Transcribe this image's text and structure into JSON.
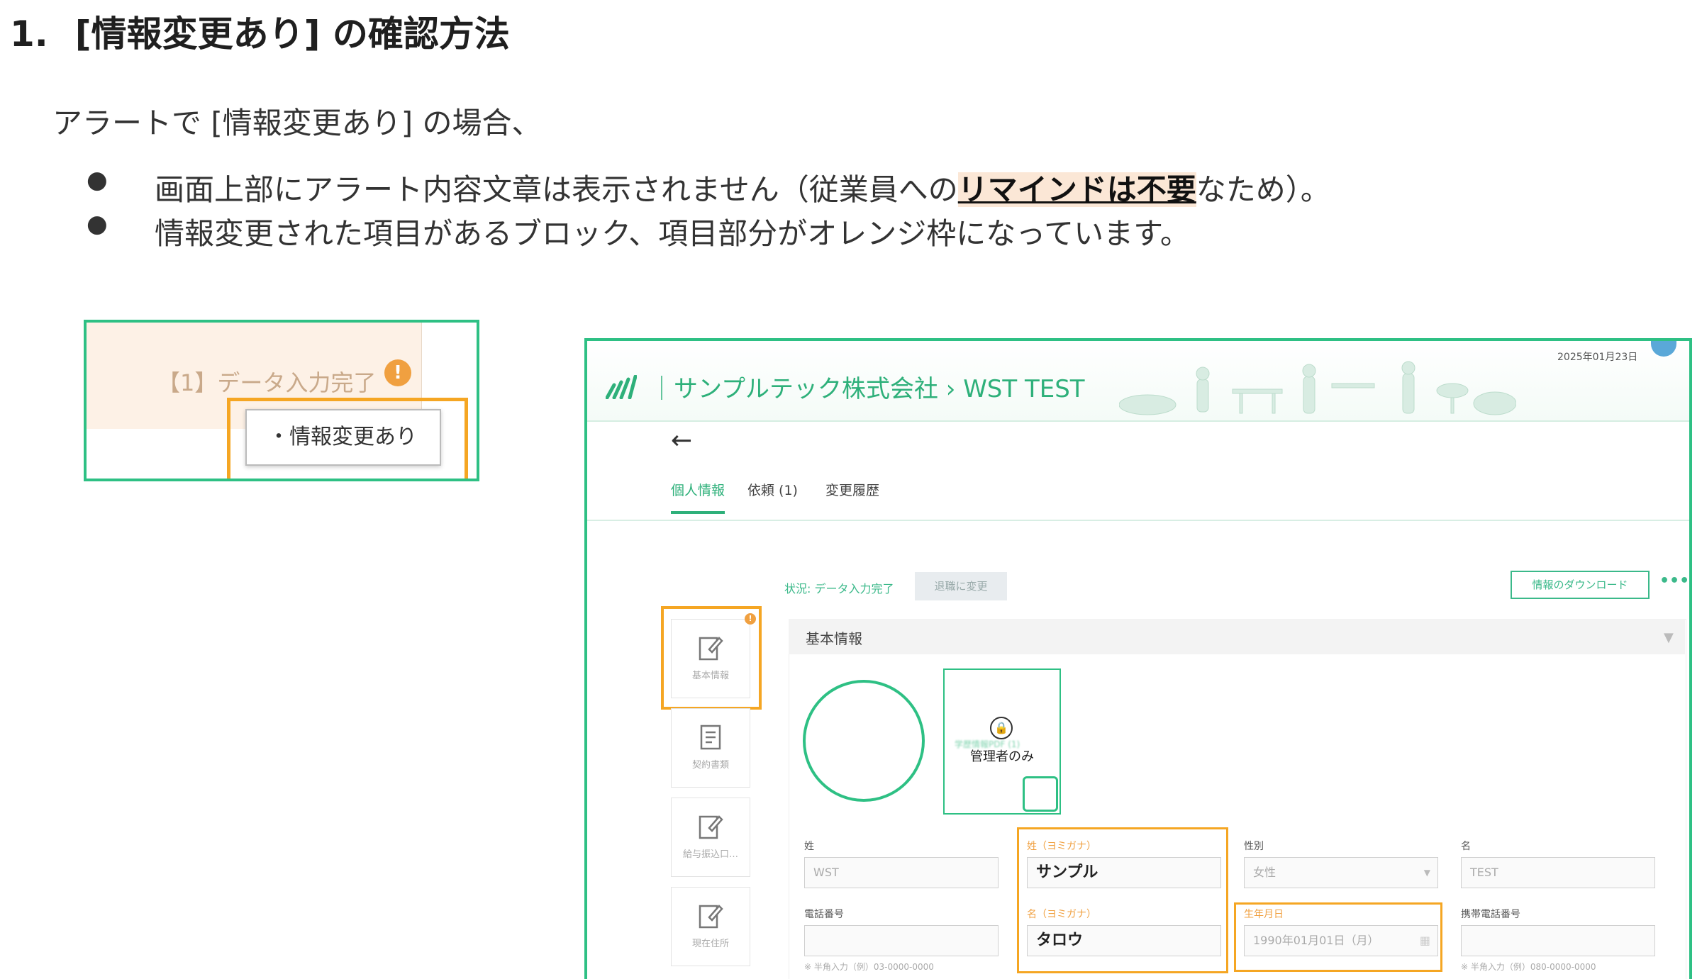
{
  "heading": {
    "number": "1.",
    "title": "[情報変更あり] の確認方法"
  },
  "intro": "アラートで [情報変更あり] の場合、",
  "bullets": [
    {
      "dot": "●",
      "pre": "画面上部にアラート内容文章は表示されません（従業員への",
      "highlight": "リマインドは不要",
      "post": "なため）。"
    },
    {
      "dot": "●",
      "text": "情報変更された項目があるブロック、項目部分がオレンジ枠になっています。"
    }
  ],
  "inset_alert": {
    "step_label": "【1】データ入力完了",
    "warn_icon": "!",
    "tooltip": "・情報変更あり"
  },
  "inset_screen": {
    "company_name": "｜サンプルテック株式会社 › WST TEST",
    "date": "2025年01月23日",
    "back_arrow": "←",
    "tabs": [
      "個人情報",
      "依頼 (1)",
      "変更履歴"
    ],
    "status": "状況: データ入力完了",
    "retire_button": "退職に変更",
    "download_button": "情報のダウンロード",
    "more": "•••",
    "side_items": [
      "基本情報",
      "契約書類",
      "給与振込口…",
      "現在住所"
    ],
    "side_badge": "!",
    "section_title": "基本情報",
    "caret": "▼",
    "admin_only": "管理者のみ",
    "card_blur_text": "学歴情報PDF (1)",
    "fields": {
      "last_name_label": "姓",
      "last_name_value": "WST",
      "last_kana_label": "姓（ヨミガナ）",
      "last_kana_value": "サンプル",
      "gender_label": "性別",
      "gender_value": "女性",
      "first_name_label": "名",
      "first_name_value": "TEST",
      "phone_label": "電話番号",
      "phone_hint": "※ 半角入力（例）03-0000-0000",
      "first_kana_label": "名（ヨミガナ）",
      "first_kana_value": "タロウ",
      "birth_label": "生年月日",
      "birth_value": "1990年01月01日（月）",
      "mobile_label": "携帯電話番号",
      "mobile_hint": "※ 半角入力（例）080-0000-0000"
    }
  },
  "colors": {
    "frame_green": "#2ec084",
    "alert_orange": "#f5a623",
    "highlight_bg": "#fbe7d6"
  }
}
